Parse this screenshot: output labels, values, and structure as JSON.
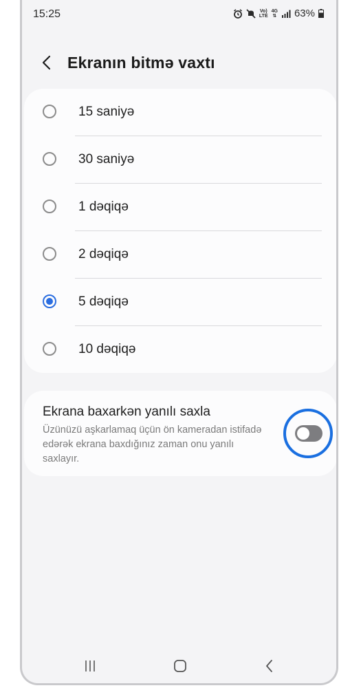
{
  "status": {
    "time": "15:25",
    "battery": "63%",
    "icons": [
      "alarm-icon",
      "mute-icon",
      "volte-icon",
      "4g-icon",
      "signal-icon",
      "battery-icon"
    ],
    "volte_line1": "Vo)",
    "volte_line2": "LTE",
    "network": "4G"
  },
  "header": {
    "title": "Ekranın bitmə vaxtı"
  },
  "options": [
    {
      "label": "15 saniyə",
      "selected": false
    },
    {
      "label": "30 saniyə",
      "selected": false
    },
    {
      "label": "1 dəqiqə",
      "selected": false
    },
    {
      "label": "2 dəqiqə",
      "selected": false
    },
    {
      "label": "5 dəqiqə",
      "selected": true
    },
    {
      "label": "10 dəqiqə",
      "selected": false
    }
  ],
  "keep_on": {
    "title": "Ekrana baxarkən yanılı saxla",
    "description": "Üzünüzü aşkarlamaq üçün ön kameradan istifadə edərək ekrana baxdığınız zaman onu yanılı saxlayır.",
    "enabled": false
  },
  "colors": {
    "accent": "#2a6de0",
    "highlight_ring": "#1a6fe0",
    "switch_off": "#7d7d80",
    "background": "#f4f4f6"
  },
  "navigation": [
    "recents-icon",
    "home-icon",
    "back-icon"
  ]
}
